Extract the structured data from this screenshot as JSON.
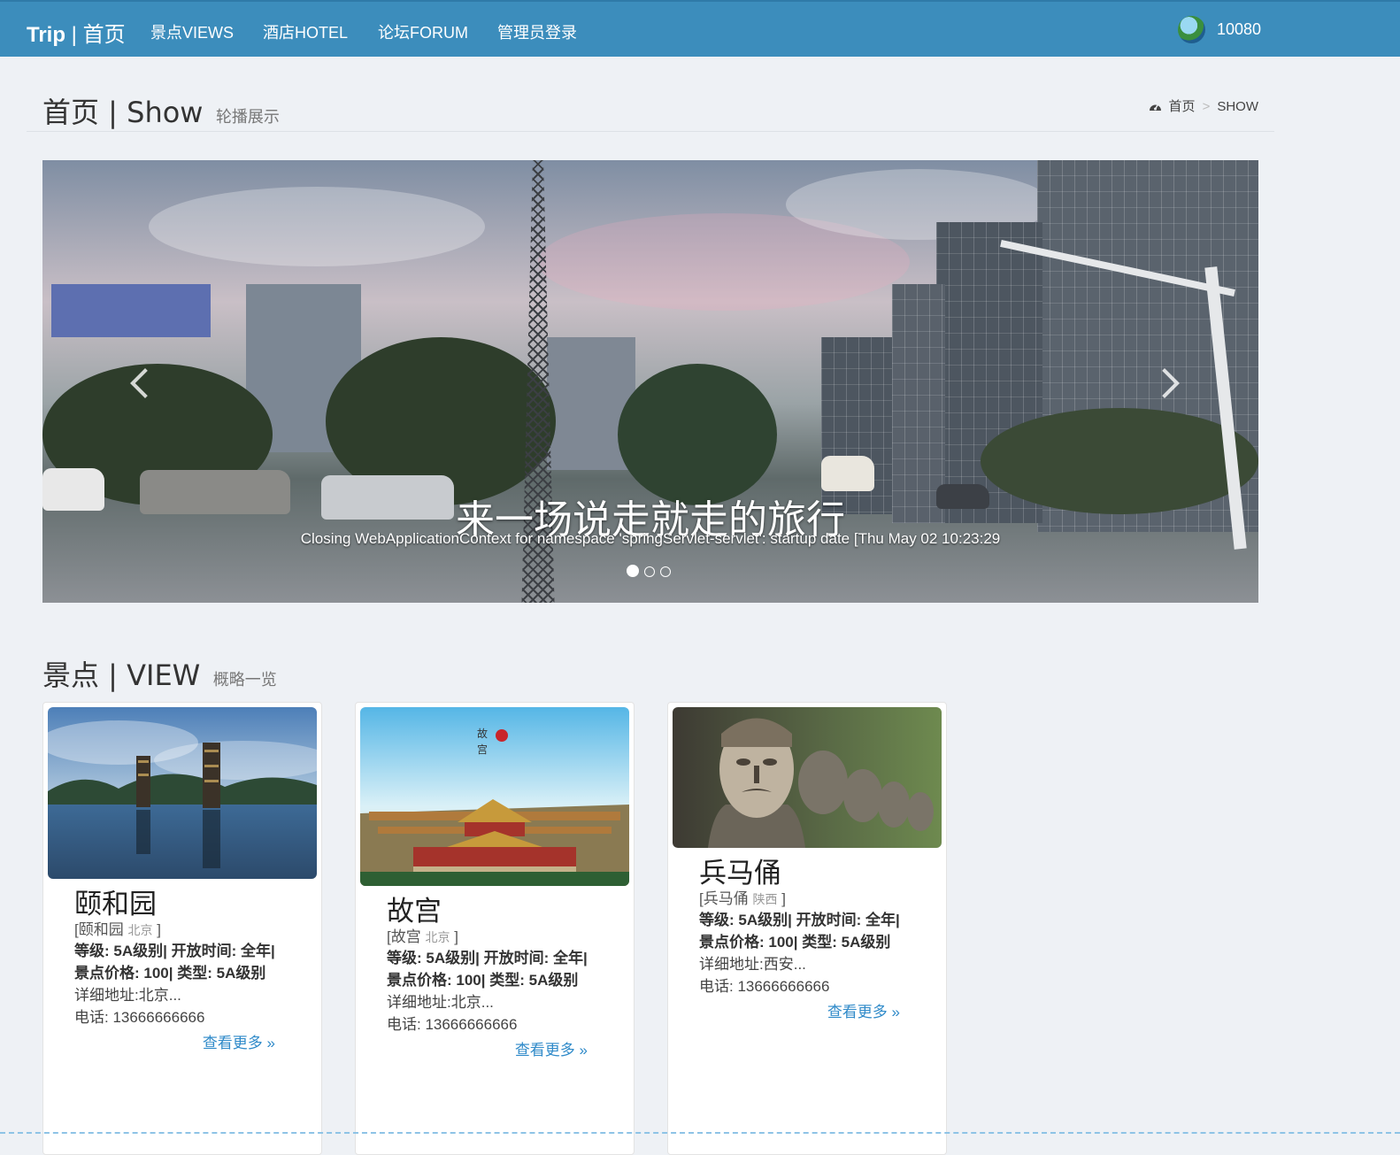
{
  "navbar": {
    "brand_strong": "Trip",
    "brand_rest": " | 首页",
    "items": [
      {
        "label": "景点VIEWS"
      },
      {
        "label": "酒店HOTEL"
      },
      {
        "label": "论坛FORUM"
      },
      {
        "label": "管理员登录"
      }
    ],
    "user": {
      "name": "10080"
    }
  },
  "page_header": {
    "title": "首页 | Show",
    "subtitle": "轮播展示",
    "breadcrumb": {
      "home_icon": "dashboard-icon",
      "home": "首页",
      "separator": ">",
      "current": "SHOW"
    }
  },
  "carousel": {
    "title": "来一场说走就走的旅行",
    "text": "Closing WebApplicationContext for namespace 'springServlet-servlet': startup date [Thu May 02 10:23:29",
    "slide_count": 3,
    "active_index": 0,
    "prev_icon": "chevron-left-icon",
    "next_icon": "chevron-right-icon"
  },
  "views_section": {
    "title": "景点 | VIEW",
    "subtitle": "概略一览",
    "cards": [
      {
        "name": "颐和园",
        "alt_open": "[颐和园",
        "province": "北京",
        "alt_close": "]",
        "info_line1": "等级: 5A级别| 开放时间: 全年|",
        "info_line2": "景点价格: 100| 类型: 5A级别",
        "address": "详细地址:北京...",
        "phone": "电话: 13666666666",
        "more": "查看更多 »"
      },
      {
        "name": "故宫",
        "alt_open": "[故宫",
        "province": "北京",
        "alt_close": "]",
        "info_line1": "等级: 5A级别| 开放时间: 全年|",
        "info_line2": "景点价格: 100| 类型: 5A级别",
        "address": "详细地址:北京...",
        "phone": "电话: 13666666666",
        "more": "查看更多 »"
      },
      {
        "name": "兵马俑",
        "alt_open": "[兵马俑",
        "province": "陕西",
        "alt_close": "]",
        "info_line1": "等级: 5A级别| 开放时间: 全年|",
        "info_line2": "景点价格: 100| 类型: 5A级别",
        "address": "详细地址:西安...",
        "phone": "电话: 13666666666",
        "more": "查看更多 »"
      }
    ]
  },
  "colors": {
    "navbar": "#3c8dbc",
    "link": "#2f8ac9",
    "background": "#eef1f5"
  }
}
